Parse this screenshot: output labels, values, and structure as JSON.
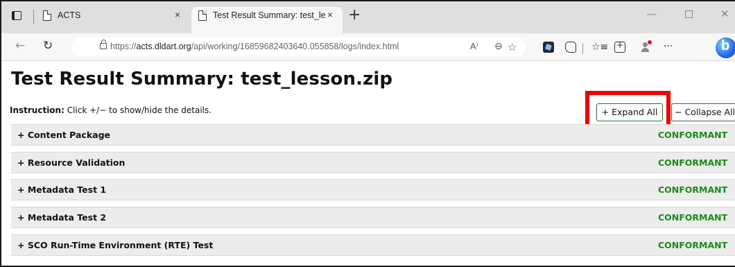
{
  "browser": {
    "tabs": [
      {
        "title": "ACTS",
        "close": "×"
      },
      {
        "title": "Test Result Summary: test_lesson",
        "close": "×"
      }
    ],
    "new_tab": "+",
    "window_controls": {
      "minimize": "—",
      "close": "✕"
    },
    "nav": {
      "back": "←",
      "refresh": "↻"
    },
    "url_prefix": "https://",
    "url_host": "acts.dldart.org",
    "url_path": "/api/working/16859682403640.055858/logs/index.html",
    "url_icons": {
      "read_aloud": "A⁾",
      "zoom": "⊖",
      "favorite": "☆"
    },
    "toolbar": {
      "favorites": "☆≡",
      "more": "···"
    },
    "icons": [
      "tab-actions-icon",
      "page-icon",
      "lock-icon",
      "extension-icon",
      "copilot-icon",
      "favorites-icon",
      "collections-icon",
      "profile-icon",
      "more-icon",
      "bing-icon"
    ],
    "accent": {
      "notification_dot": "#e81123"
    }
  },
  "page": {
    "title": "Test Result Summary: test_lesson.zip",
    "instruction_label": "Instruction:",
    "instruction_text": " Click +/− to show/hide the details.",
    "expand_all": "+ Expand All",
    "collapse_all": "− Collapse All",
    "highlight_color": "#ee0000",
    "status_color": "#1a8a1a",
    "sections": [
      {
        "label": "+ Content Package",
        "status": "CONFORMANT"
      },
      {
        "label": "+ Resource Validation",
        "status": "CONFORMANT"
      },
      {
        "label": "+ Metadata Test 1",
        "status": "CONFORMANT"
      },
      {
        "label": "+ Metadata Test 2",
        "status": "CONFORMANT"
      },
      {
        "label": "+ SCO Run-Time Environment (RTE) Test",
        "status": "CONFORMANT"
      }
    ]
  }
}
